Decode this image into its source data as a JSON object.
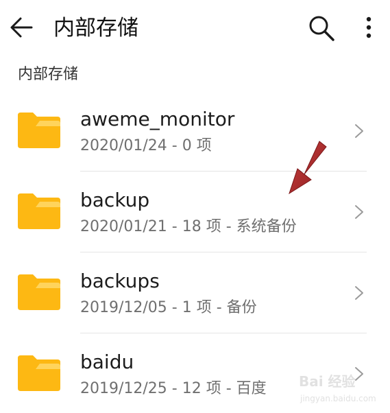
{
  "appbar": {
    "title": "内部存储",
    "back_icon": "arrow-left-icon",
    "search_icon": "search-icon",
    "more_icon": "more-vertical-icon"
  },
  "breadcrumb": "内部存储",
  "folders": [
    {
      "name": "aweme_monitor",
      "meta": "2020/01/24 - 0 项"
    },
    {
      "name": "backup",
      "meta": "2020/01/21 - 18 项 - 系统备份"
    },
    {
      "name": "backups",
      "meta": "2019/12/05 - 1 项 - 备份"
    },
    {
      "name": "baidu",
      "meta": "2019/12/25 - 12 项 - 百度"
    }
  ],
  "colors": {
    "folder": "#FDB813",
    "folder_tab": "#FFD45C",
    "annotation_arrow": "#A8282A"
  },
  "watermark": {
    "logo": "Bai 经验",
    "sub": "jingyan.baidu.com"
  }
}
